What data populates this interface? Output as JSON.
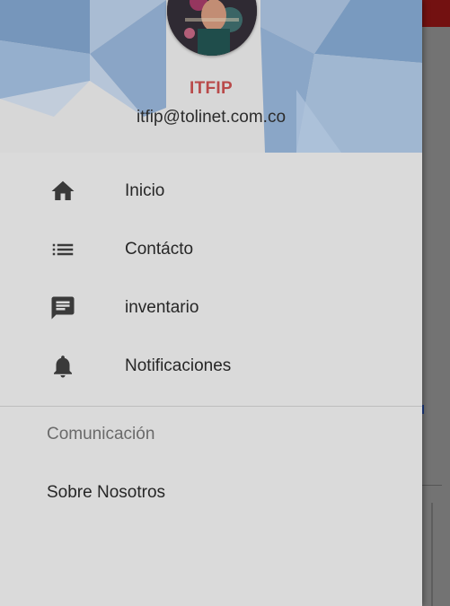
{
  "header": {
    "name": "ITFIP",
    "email": "itfip@tolinet.com.co"
  },
  "menu": {
    "items": [
      {
        "label": "Inicio",
        "icon": "home-icon"
      },
      {
        "label": "Contácto",
        "icon": "list-icon"
      },
      {
        "label": "inventario",
        "icon": "message-icon"
      },
      {
        "label": "Notificaciones",
        "icon": "bell-icon"
      }
    ]
  },
  "communication": {
    "section_title": "Comunicación",
    "items": [
      {
        "label": "Sobre Nosotros"
      }
    ]
  },
  "colors": {
    "drawer_bg": "#dadada",
    "header_name": "#b94a4a",
    "pattern_blue": "#6f93bd",
    "icon": "#3a3a3a"
  }
}
